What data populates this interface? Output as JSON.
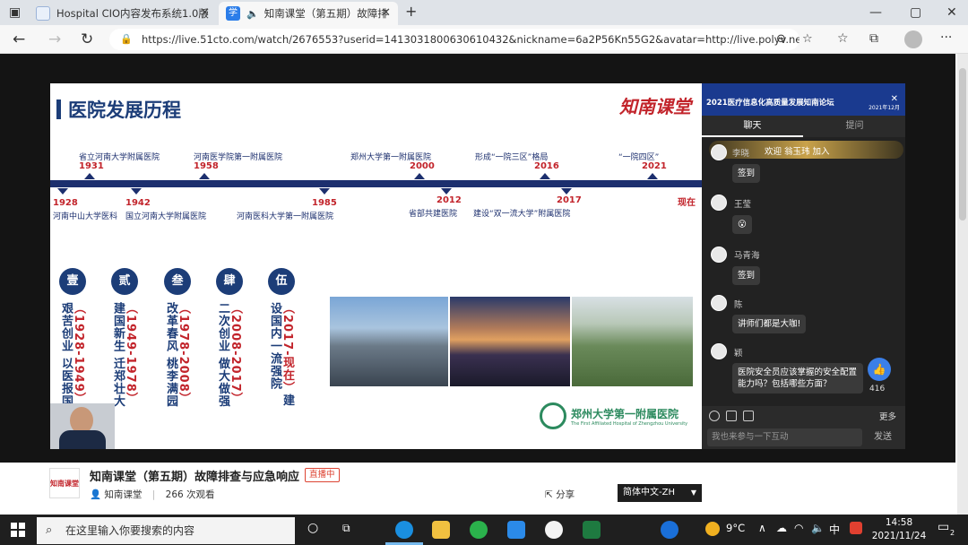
{
  "browser": {
    "tabs": [
      {
        "title": "Hospital CIO内容发布系统1.0版",
        "active": false
      },
      {
        "title": "知南课堂（第五期）故障排",
        "active": true
      }
    ],
    "url": "https://live.51cto.com/watch/2676553?userid=1413031800630610432&nickname=6a2P56Kn55G2&avatar=http://live.polyv.net/ass..."
  },
  "slide": {
    "title": "医院发展历程",
    "logo_text": "知南课堂",
    "events_top": [
      {
        "inst": "省立河南大学附属医院",
        "year": "1931"
      },
      {
        "inst": "河南医学院第一附属医院",
        "year": "1958"
      },
      {
        "inst": "郑州大学第一附属医院",
        "year": "2000"
      },
      {
        "inst": "形成“一院三区”格局",
        "year": "2016"
      },
      {
        "inst": "“一院四区”",
        "year": "2021"
      }
    ],
    "events_bottom": [
      {
        "year": "1928",
        "inst": "河南中山大学医科"
      },
      {
        "year": "1942",
        "inst": "国立河南大学附属医院"
      },
      {
        "year": "1985",
        "inst": "河南医科大学第一附属医院"
      },
      {
        "year": "2012",
        "inst": "省部共建医院"
      },
      {
        "year": "2017",
        "inst": "建设“双一流大学”附属医院"
      }
    ],
    "now_label": "现在",
    "phases": [
      {
        "num": "壹",
        "text": "艰苦创业 以医报国",
        "years": "（1928-1949）"
      },
      {
        "num": "贰",
        "text": "建国新生 迁郑壮大",
        "years": "（1949-1978）"
      },
      {
        "num": "叁",
        "text": "改革春风 桃李满园",
        "years": "（1978-2008）"
      },
      {
        "num": "肆",
        "text": "二次创业 做大做强",
        "years": "（2008-2017）"
      },
      {
        "num": "伍",
        "text": "建设国内一流强院",
        "years": "（2017-现在）"
      }
    ],
    "hospital_name": "郑州大学第一附属医院",
    "hospital_name_en": "The First Affiliated Hospital of Zhengzhou University"
  },
  "chat": {
    "banner_title": "2021医疗信息化高质量发展知南论坛",
    "banner_date": "2021年12月",
    "tabs": [
      "聊天",
      "提问"
    ],
    "join_notice": "欢迎 翁玉玮 加入",
    "messages": [
      {
        "user": "李晓",
        "text": "签到"
      },
      {
        "user": "王莹",
        "text": "😮"
      },
      {
        "user": "马青海",
        "text": "签到"
      },
      {
        "user": "陈",
        "text": "讲师们都是大咖!"
      },
      {
        "user": "颖",
        "text": "医院安全员应该掌握的安全配置能力吗？包括哪些方面？"
      }
    ],
    "like_count": "416",
    "more_label": "更多",
    "input_placeholder": "我也来参与一下互动",
    "send_label": "发送"
  },
  "course": {
    "logo_text": "知南课堂",
    "title": "知南课堂（第五期）故障排查与应急响应",
    "status": "直播中",
    "host": "知南课堂",
    "views": "266 次观看",
    "share_label": "分享",
    "language": "简体中文-ZH"
  },
  "taskbar": {
    "search_placeholder": "在这里输入你要搜索的内容",
    "temperature": "9°C",
    "ime": "中",
    "time": "14:58",
    "date": "2021/11/24",
    "notification_count": "2"
  }
}
